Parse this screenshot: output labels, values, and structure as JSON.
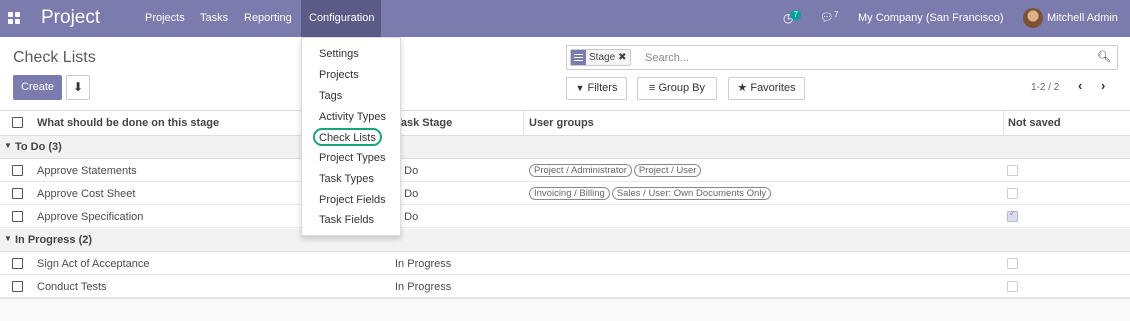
{
  "navbar": {
    "brand": "Project",
    "menus": [
      "Projects",
      "Tasks",
      "Reporting",
      "Configuration"
    ],
    "activity_count": "7",
    "message_count": "7",
    "company": "My Company (San Francisco)",
    "user": "Mitchell Admin",
    "colors": {
      "bar": "#7c7bad",
      "active": "#5c5b88"
    }
  },
  "control": {
    "title": "Check Lists",
    "create_label": "Create",
    "search": {
      "facet_label": "Stage",
      "placeholder": "Search..."
    },
    "filters_label": "Filters",
    "groupby_label": "Group By",
    "favorites_label": "Favorites",
    "pager": "1-2 / 2"
  },
  "table": {
    "columns": [
      "What should be done on this stage",
      "Task Stage",
      "User groups",
      "Not saved"
    ],
    "groups": [
      {
        "label": "To Do (3)",
        "rows": [
          {
            "name": "Approve Statements",
            "stage": "o Do",
            "groups": [
              "Project / Administrator",
              "Project / User"
            ],
            "not_saved": false
          },
          {
            "name": "Approve Cost Sheet",
            "stage": "o Do",
            "groups": [
              "Invoicing / Billing",
              "Sales / User: Own Documents Only"
            ],
            "not_saved": false
          },
          {
            "name": "Approve Specification",
            "stage": "o Do",
            "groups": [],
            "not_saved": true
          }
        ]
      },
      {
        "label": "In Progress (2)",
        "rows": [
          {
            "name": "Sign Act of Acceptance",
            "stage": "In Progress",
            "groups": [],
            "not_saved": false
          },
          {
            "name": "Conduct Tests",
            "stage": "In Progress",
            "groups": [],
            "not_saved": false
          }
        ]
      }
    ]
  },
  "config_menu": {
    "items": [
      "Settings",
      "Projects",
      "Tags",
      "Activity Types",
      "Check Lists",
      "Project Types",
      "Task Types",
      "Project Fields",
      "Task Fields"
    ],
    "highlighted": "Check Lists",
    "highlight_color": "#1aa37a"
  }
}
